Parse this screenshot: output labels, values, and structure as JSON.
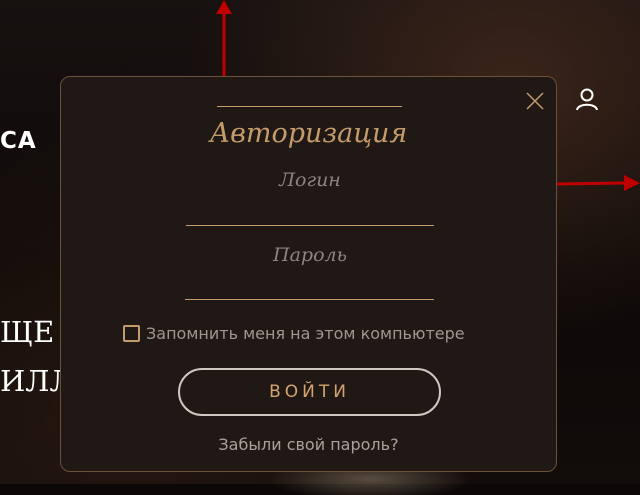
{
  "header": {
    "logo_text": "CA",
    "user_icon": "user-icon"
  },
  "hero": {
    "line1": "ЩЕ",
    "line2": "ИЛЛ"
  },
  "annotations": {
    "color": "#c00000",
    "arrows": [
      "arrow-up-icon",
      "arrow-right-icon"
    ]
  },
  "modal": {
    "title": "Авторизация",
    "close_icon": "close-icon",
    "login": {
      "label": "Логин",
      "value": ""
    },
    "password": {
      "label": "Пароль",
      "value": ""
    },
    "remember": {
      "label": "Запомнить меня на этом компьютере",
      "checked": false
    },
    "submit_label": "ВОЙТИ",
    "forgot_link": "Забыли свой пароль?"
  },
  "colors": {
    "accent_gold": "#c49b6b",
    "modal_bg": "#201815",
    "page_bg": "#0c0807",
    "button_border": "#cfc7c2",
    "muted_text": "#9d9792"
  }
}
